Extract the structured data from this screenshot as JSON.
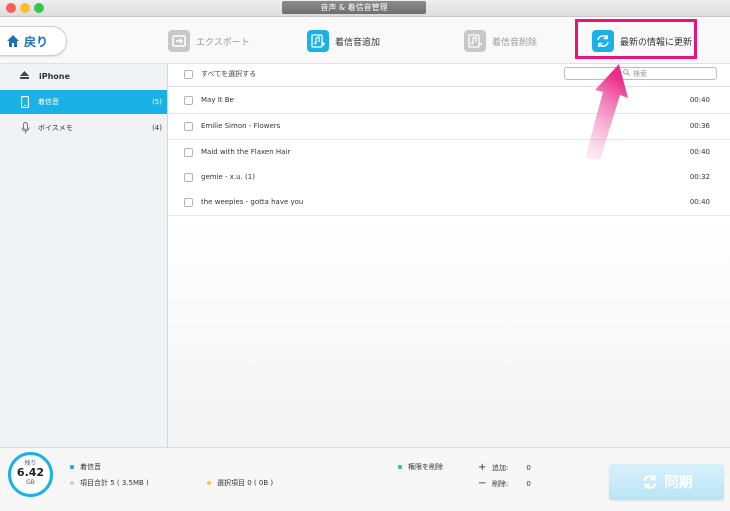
{
  "window": {
    "title": "音声 & 着信音管理"
  },
  "toolbar": {
    "back_label": "戻り",
    "export_label": "エクスポート",
    "add_label": "着信音追加",
    "delete_label": "着信音削除",
    "refresh_label": "最新の情報に更新"
  },
  "sidebar": {
    "device": "iPhone",
    "items": [
      {
        "label": "着信音",
        "count": "(5)"
      },
      {
        "label": "ボイスメモ",
        "count": "(4)"
      }
    ]
  },
  "list": {
    "select_all": "すべてを選択する",
    "search_placeholder": "検索",
    "rows": [
      {
        "name": "May It Be",
        "duration": "00:40"
      },
      {
        "name": "Emilie Simon - Flowers",
        "duration": "00:36"
      },
      {
        "name": "Maid with the Flaxen Hair",
        "duration": "00:40"
      },
      {
        "name": "gemie - x.u. (1)",
        "duration": "00:32"
      },
      {
        "name": "the weepies - gotta have you",
        "duration": "00:40"
      }
    ]
  },
  "footer": {
    "gauge": {
      "remaining_label": "残り",
      "value": "6.42",
      "unit": "GB"
    },
    "legend_ringtone": "着信音",
    "total_items": "項目合計 5 ( 3.5MB )",
    "selected_items": "選択項目 0 ( 0B )",
    "permission_delete": "権限を削除",
    "add_label": "追加:",
    "add_value": "0",
    "remove_label": "削除:",
    "remove_value": "0",
    "sync_label": "同期"
  },
  "colors": {
    "accent": "#1ab2e6",
    "highlight": "#e8137b",
    "ringtone_dot": "#1ab2e6",
    "selected_dot": "#f5c542",
    "permission_dot": "#3cc58a"
  }
}
